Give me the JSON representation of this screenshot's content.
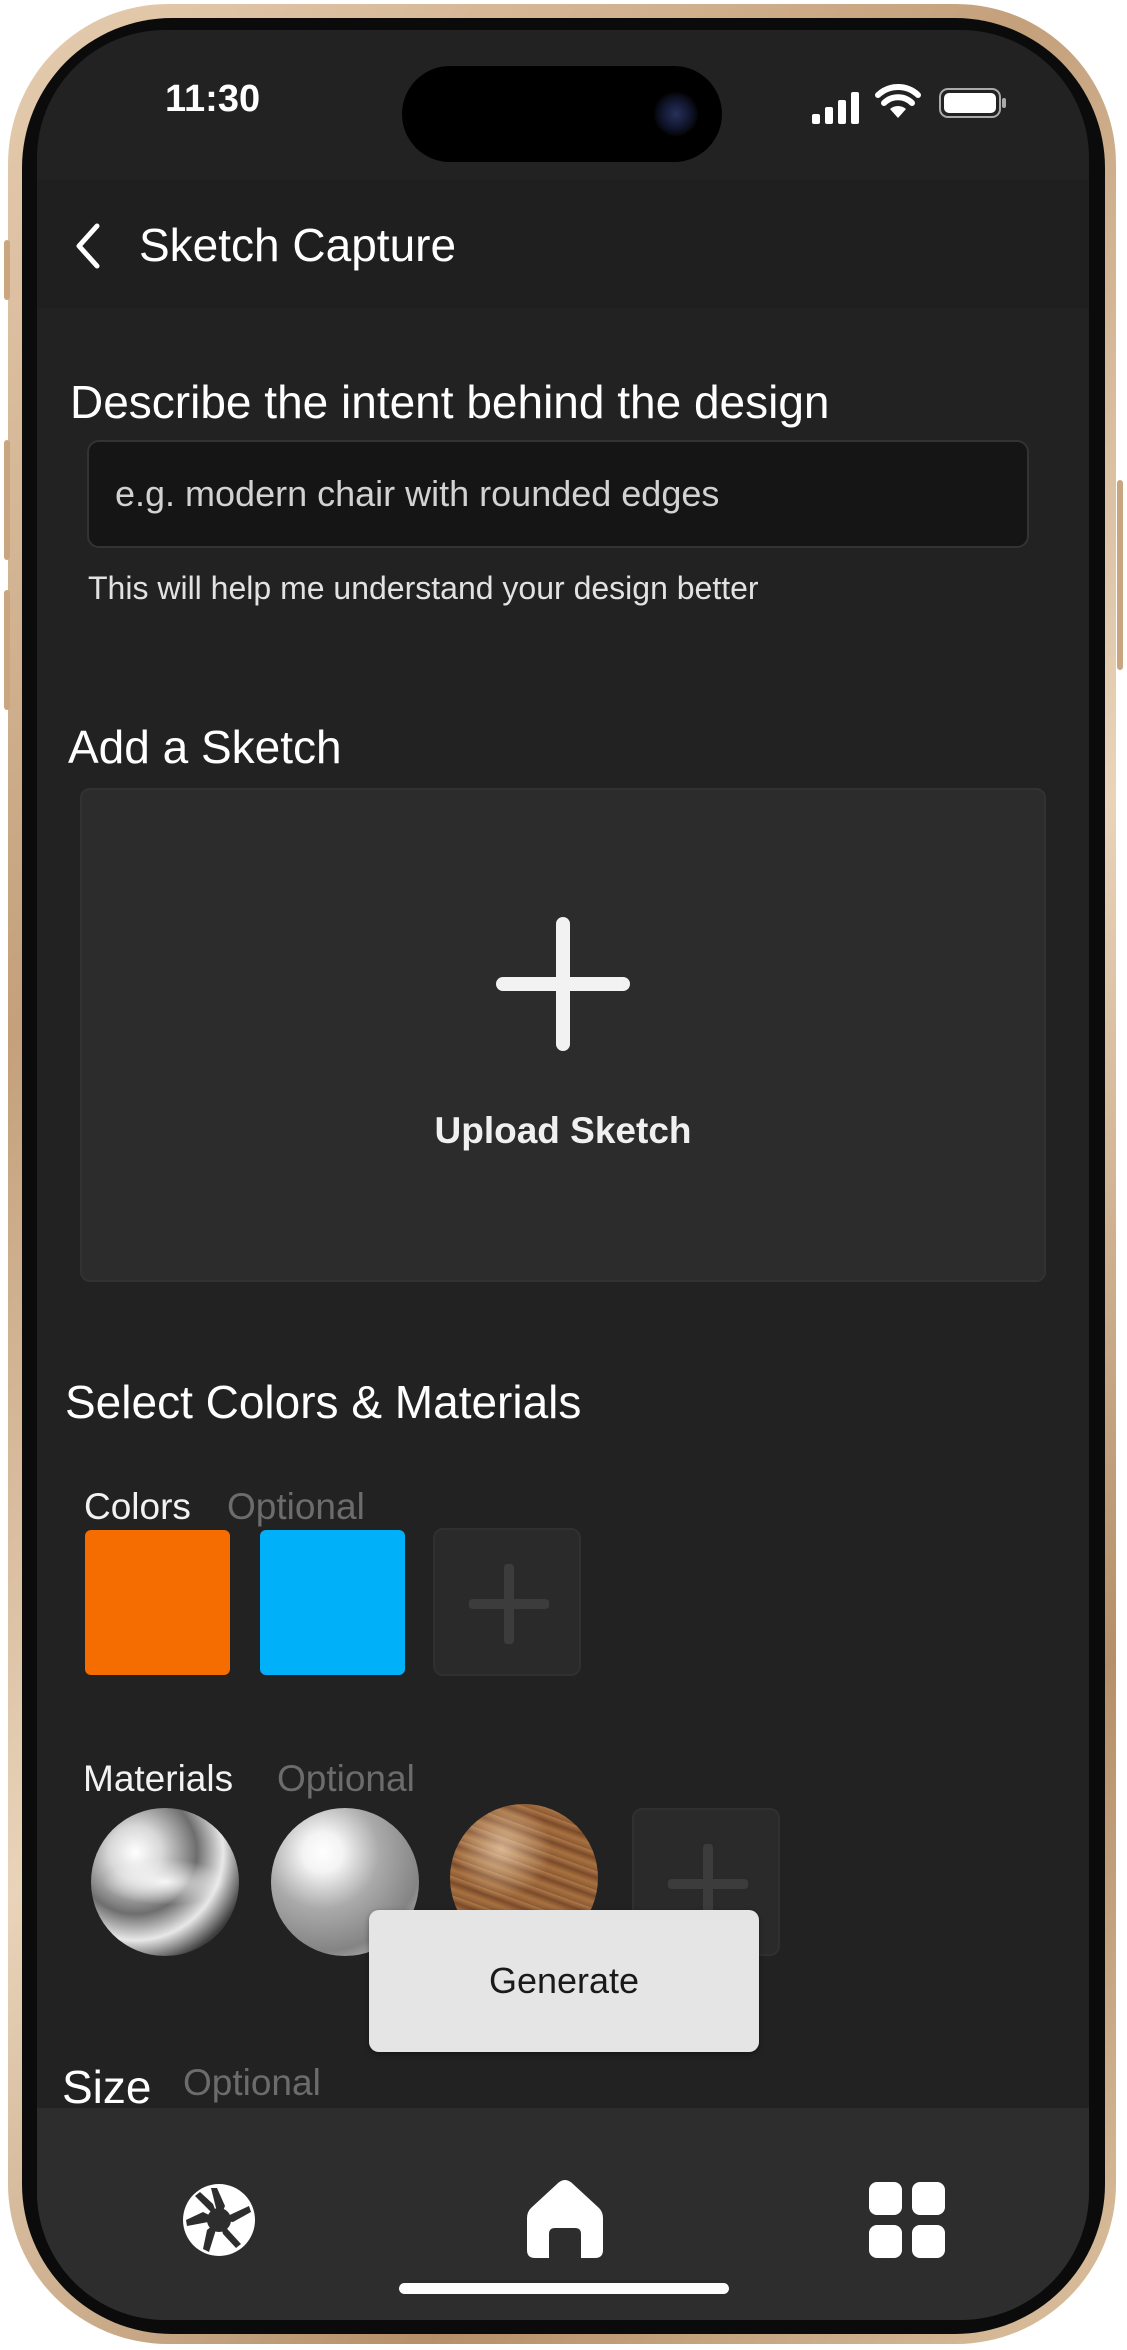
{
  "status_bar": {
    "time": "11:30"
  },
  "header": {
    "title": "Sketch Capture"
  },
  "intent": {
    "heading": "Describe the intent behind the design",
    "placeholder": "e.g. modern chair with rounded edges",
    "hint": "This will help me understand your design better"
  },
  "sketch": {
    "heading": "Add a Sketch",
    "upload_label": "Upload Sketch"
  },
  "colors_materials": {
    "heading": "Select Colors & Materials",
    "colors_label": "Colors",
    "colors_optional": "Optional",
    "colors": [
      "#f56c00",
      "#00b0f8"
    ],
    "materials_label": "Materials",
    "materials_optional": "Optional",
    "materials": [
      "chrome",
      "glass",
      "wood"
    ]
  },
  "size": {
    "label": "Size",
    "optional": "Optional"
  },
  "generate": {
    "label": "Generate"
  },
  "tabbar": {
    "tabs": [
      {
        "icon": "camera-aperture-icon"
      },
      {
        "icon": "home-icon"
      },
      {
        "icon": "grid-icon"
      }
    ]
  }
}
